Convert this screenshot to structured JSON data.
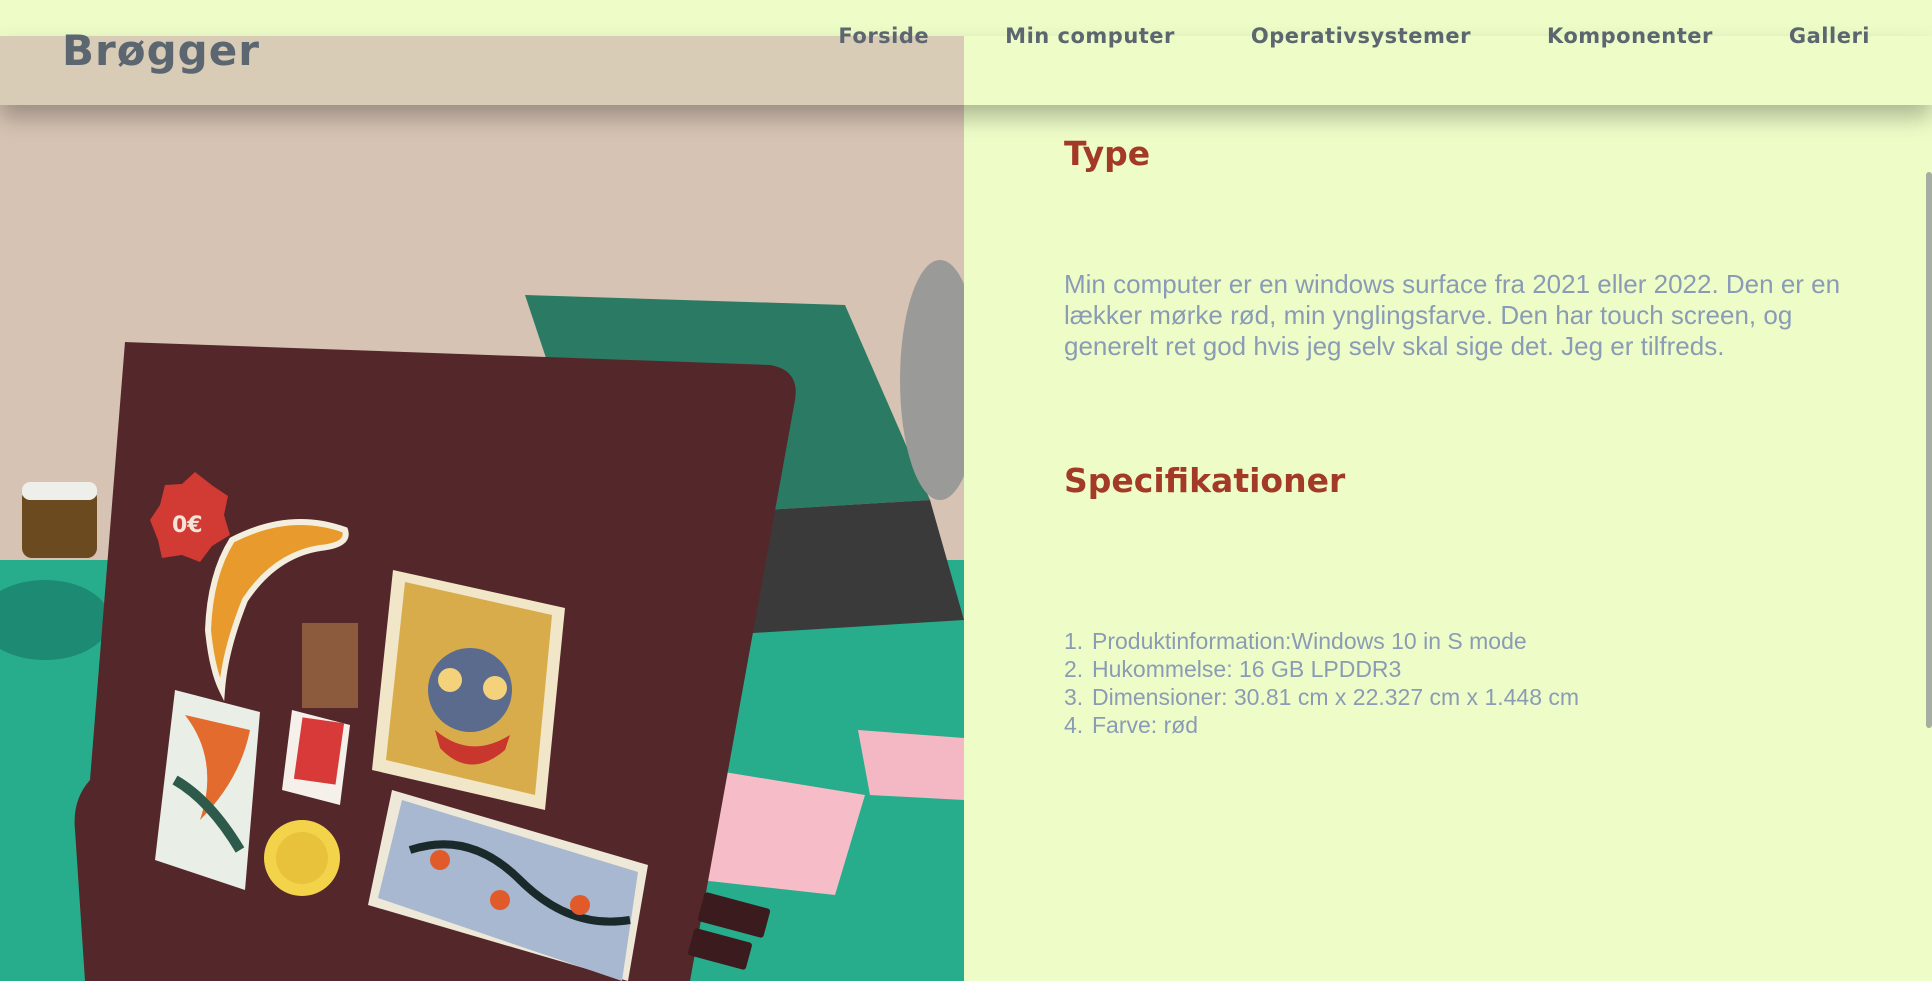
{
  "site": {
    "logo": "Brøgger"
  },
  "nav": {
    "items": [
      {
        "label": "Forside"
      },
      {
        "label": "Min computer"
      },
      {
        "label": "Operativsystemer"
      },
      {
        "label": "Komponenter"
      },
      {
        "label": "Galleri"
      }
    ]
  },
  "main": {
    "type_heading": "Type",
    "type_paragraph": "Min computer er en windows surface fra 2021 eller 2022. Den er en lækker mørke rød, min ynglingsfarve. Den har touch screen, og generelt ret god hvis jeg selv skal sige det. Jeg er tilfreds.",
    "spec_heading": "Specifikationer",
    "specs": [
      {
        "num": "1.",
        "text": "Produktinformation:Windows 10 in S mode"
      },
      {
        "num": "2.",
        "text": "Hukommelse: 16 GB LPDDR3"
      },
      {
        "num": "3.",
        "text": "Dimensioner: 30.81 cm x 22.327 cm x 1.448 cm"
      },
      {
        "num": "4.",
        "text": "Farve: rød"
      }
    ]
  },
  "photo": {
    "description_icon": "laptop-with-stickers-photo",
    "sticker_text": "0€"
  },
  "colors": {
    "background": "#eefdc8",
    "heading": "#a33a28",
    "body_text": "#8a9bb6",
    "nav_text": "#5c6670"
  }
}
